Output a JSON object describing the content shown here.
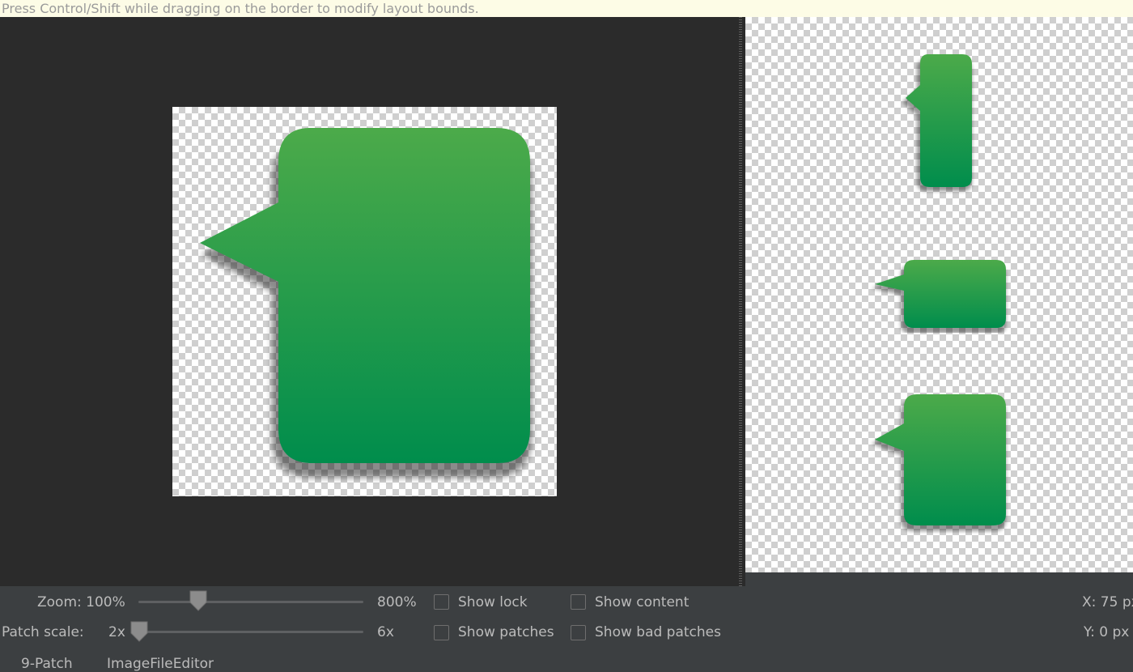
{
  "hint": "Press Control/Shift while dragging on the border to modify layout bounds.",
  "controls": {
    "zoom_label": "Zoom: 100%",
    "zoom_max": "800%",
    "zoom_level": 0.1,
    "patch_scale_label": "Patch scale:",
    "patch_scale_min": "2x",
    "patch_scale_max": "6x",
    "patch_scale_value": 2,
    "show_lock": "Show lock",
    "show_content": "Show content",
    "show_patches": "Show patches",
    "show_bad_patches": "Show bad patches",
    "x_coord": "X: 75 px",
    "y_coord": "Y:   0 px"
  },
  "tabs": {
    "nine_patch": "9-Patch",
    "image_file_editor": "ImageFileEditor"
  },
  "colors": {
    "bubble_top": "#4caa4a",
    "bubble_bottom": "#008d4c"
  }
}
